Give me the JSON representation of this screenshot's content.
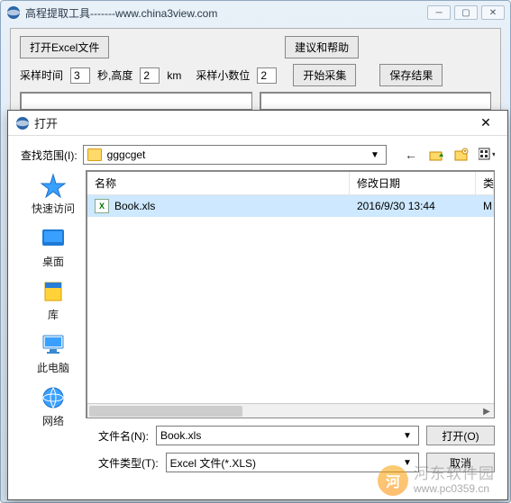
{
  "main": {
    "title": "高程提取工具-------www.china3view.com",
    "btn_open_excel": "打开Excel文件",
    "btn_help": "建议和帮助",
    "btn_save": "保存结果",
    "label_sample_time": "采样时间",
    "val_sample_time": "3",
    "label_seconds_height": "秒,高度",
    "val_height": "2",
    "label_km": "km",
    "label_decimals": "采样小数位",
    "val_decimals": "2",
    "btn_start": "开始采集"
  },
  "dialog": {
    "title": "打开",
    "lookup_label": "查找范围(I):",
    "lookup_value": "gggcget",
    "sidebar": [
      {
        "label": "快速访问",
        "key": "quick-access"
      },
      {
        "label": "桌面",
        "key": "desktop"
      },
      {
        "label": "库",
        "key": "libraries"
      },
      {
        "label": "此电脑",
        "key": "this-pc"
      },
      {
        "label": "网络",
        "key": "network"
      }
    ],
    "columns": {
      "name": "名称",
      "date": "修改日期",
      "type": "类"
    },
    "files": [
      {
        "name": "Book.xls",
        "date": "2016/9/30 13:44",
        "type": "M",
        "selected": true
      }
    ],
    "filename_label": "文件名(N):",
    "filename_value": "Book.xls",
    "filetype_label": "文件类型(T):",
    "filetype_value": "Excel 文件(*.XLS)",
    "btn_open": "打开(O)",
    "btn_cancel": "取消"
  },
  "watermark": {
    "brand": "河东软件园",
    "url": "www.pc0359.cn"
  }
}
